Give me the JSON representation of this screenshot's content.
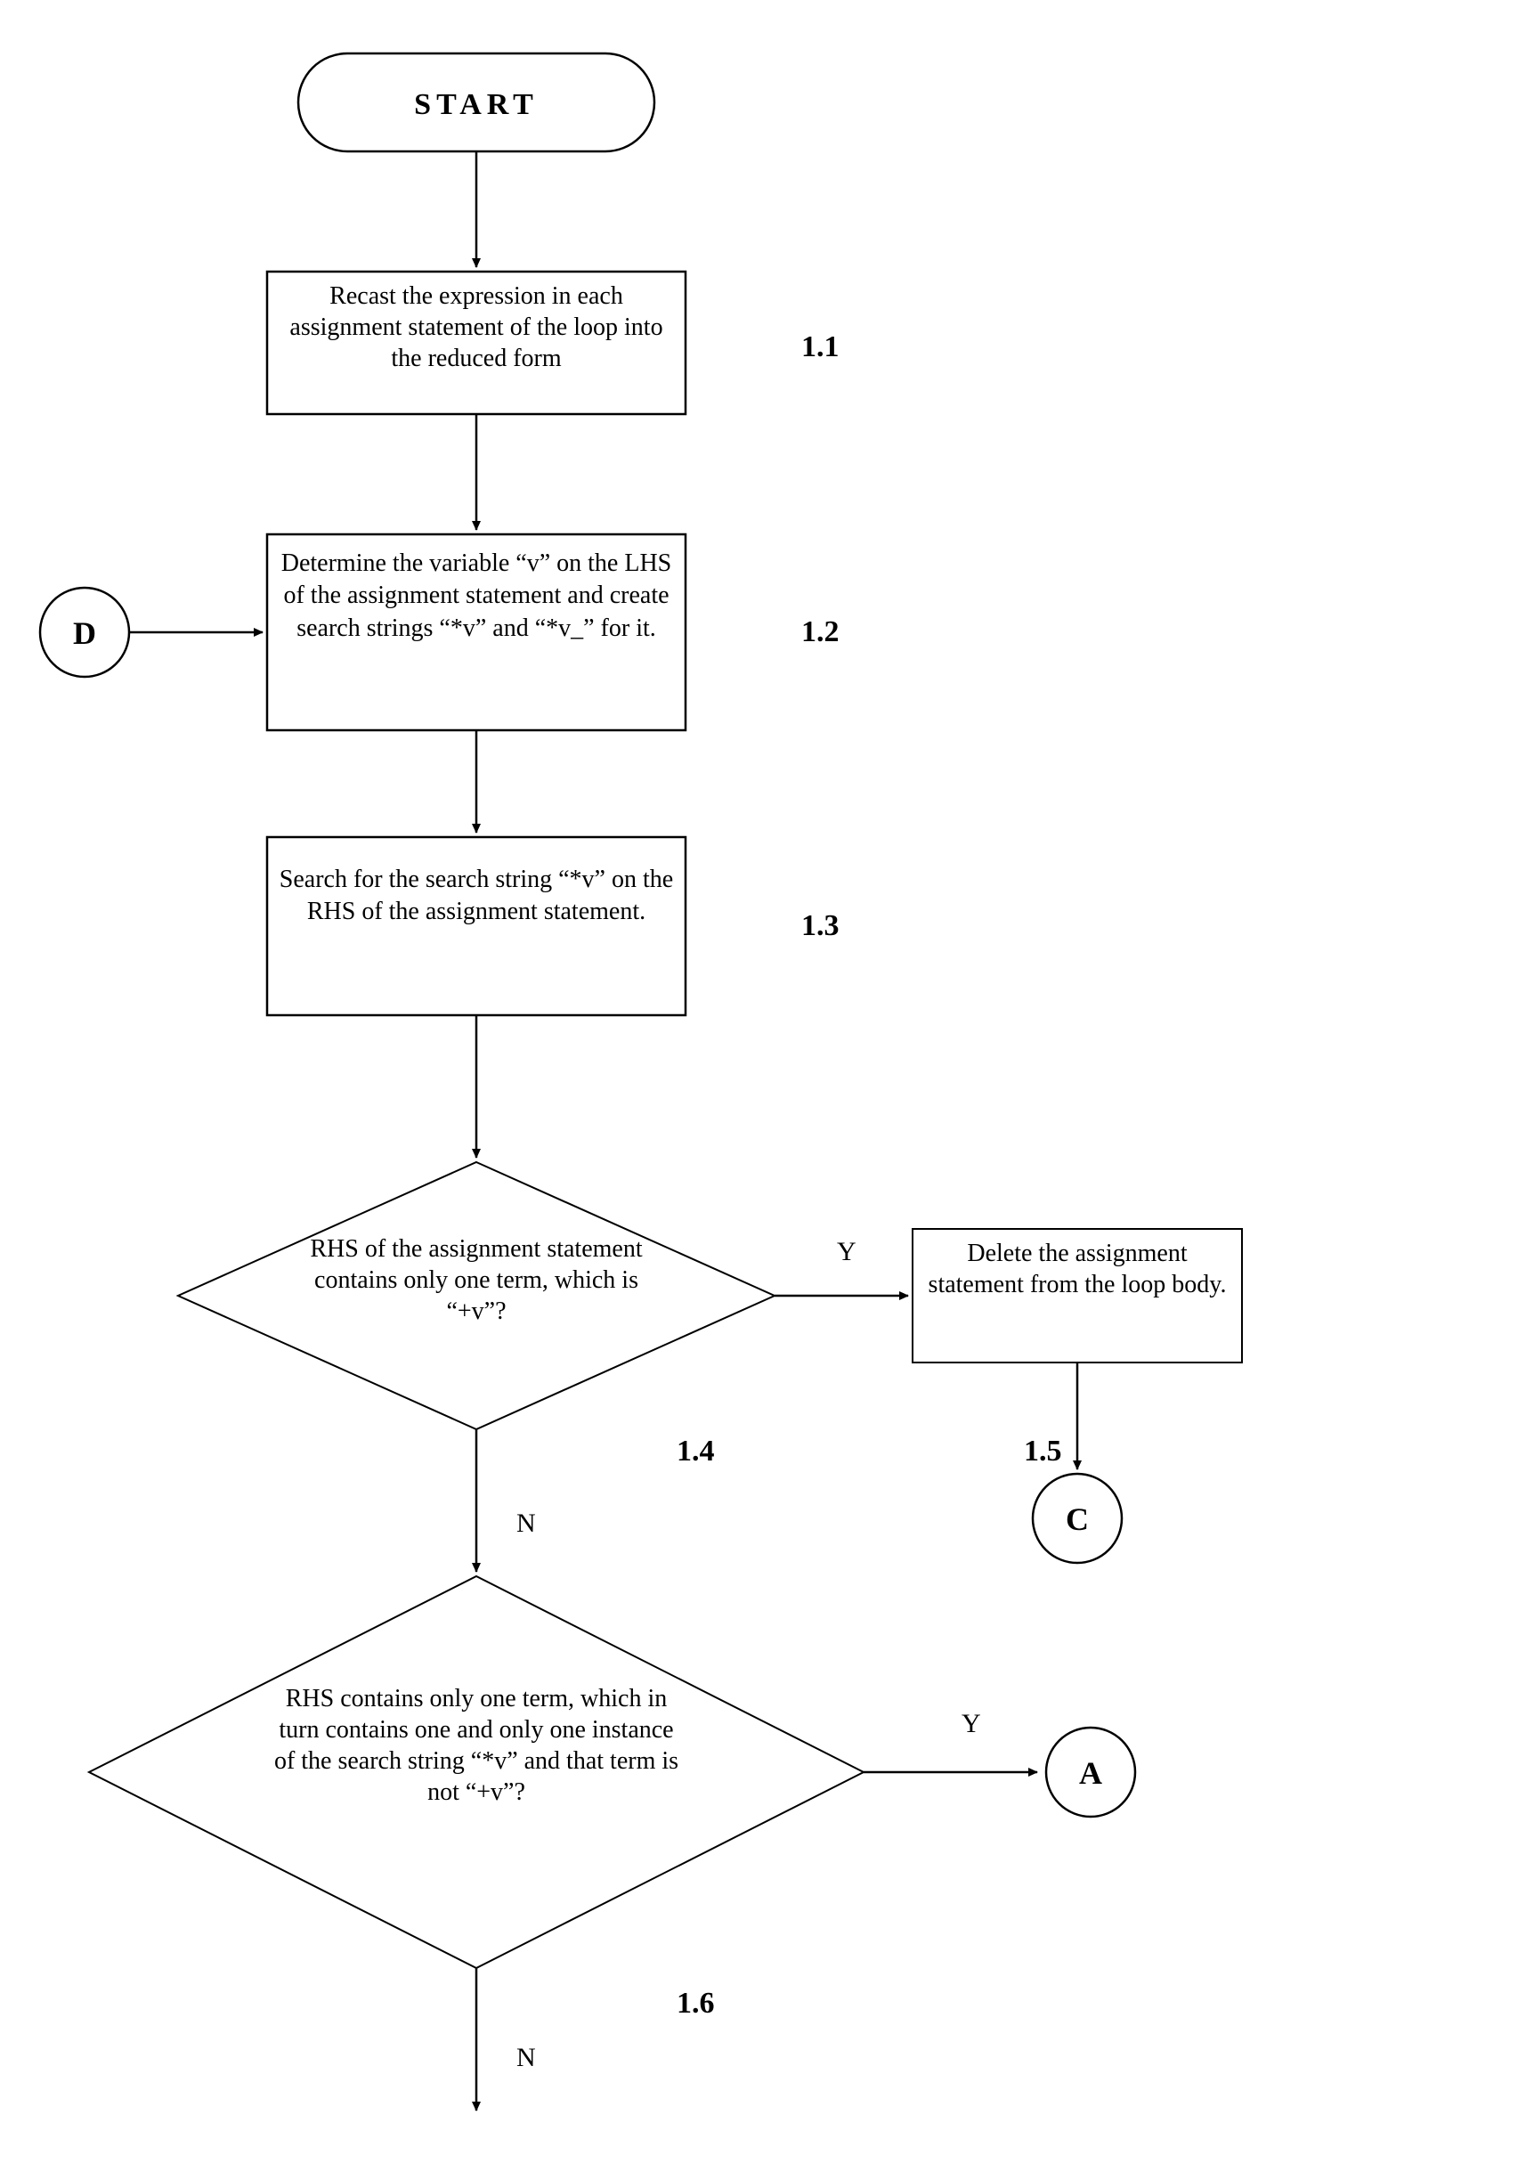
{
  "start": "START",
  "steps": {
    "s1_1": "Recast the expression in each assignment statement of the loop into the reduced form",
    "s1_2": "Determine the variable “v” on the LHS of the assignment statement and create search strings “*v” and “*v_” for it.",
    "s1_3": "Search for the search string “*v” on the RHS of the assignment statement.",
    "s1_4": "RHS of the assignment statement contains only one term, which is “+v”?",
    "s1_5": "Delete the assignment statement from the loop body.",
    "s1_6": "RHS contains only one term, which in turn contains one and only one instance of the search string “*v” and that term is not “+v”?"
  },
  "labels": {
    "l1_1": "1.1",
    "l1_2": "1.2",
    "l1_3": "1.3",
    "l1_4": "1.4",
    "l1_5": "1.5",
    "l1_6": "1.6"
  },
  "yn": {
    "Y": "Y",
    "N": "N"
  },
  "connectors": {
    "D": "D",
    "C": "C",
    "A": "A"
  }
}
